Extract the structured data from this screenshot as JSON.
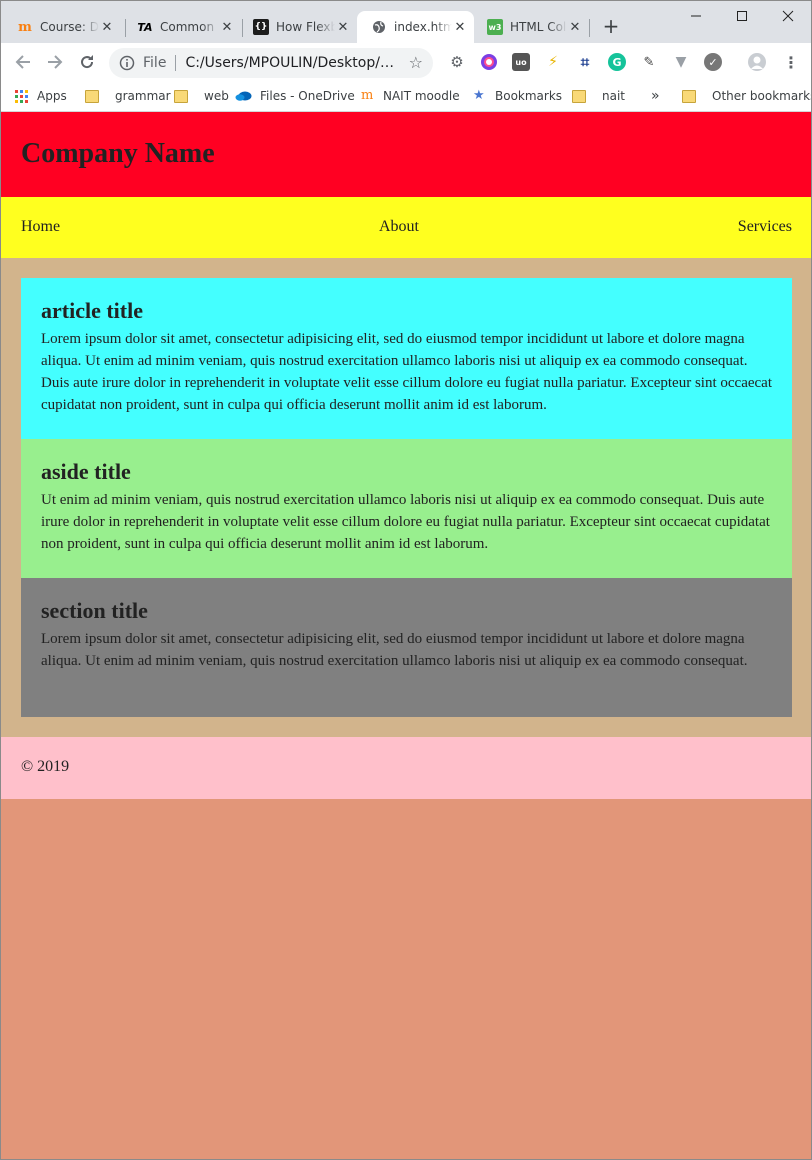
{
  "browser": {
    "tabs": [
      {
        "title": "Course: D",
        "favicon": "moodle-icon"
      },
      {
        "title": "Common",
        "favicon": "ta-icon"
      },
      {
        "title": "How Flexb",
        "favicon": "braces-icon"
      },
      {
        "title": "index.html",
        "favicon": "globe-icon",
        "active": true
      },
      {
        "title": "HTML Col",
        "favicon": "w3-icon"
      }
    ],
    "new_tab": "+",
    "address": {
      "scheme": "File",
      "url": "C:/Users/MPOULIN/Desktop/flexbox/index.html"
    },
    "bookmarks": [
      {
        "label": "Apps",
        "icon": "apps-grid-icon"
      },
      {
        "label": "grammar",
        "icon": "folder-icon"
      },
      {
        "label": "web",
        "icon": "folder-icon"
      },
      {
        "label": "Files - OneDrive",
        "icon": "onedrive-icon"
      },
      {
        "label": "NAIT moodle",
        "icon": "moodle-icon"
      },
      {
        "label": "Bookmarks",
        "icon": "star-icon"
      },
      {
        "label": "nait",
        "icon": "folder-icon"
      }
    ],
    "bookmarks_overflow": "»",
    "other_bookmarks": "Other bookmarks"
  },
  "page": {
    "header_title": "Company Name",
    "nav": [
      "Home",
      "About",
      "Services"
    ],
    "article": {
      "title": "article title",
      "text": "Lorem ipsum dolor sit amet, consectetur adipisicing elit, sed do eiusmod tempor incididunt ut labore et dolore magna aliqua. Ut enim ad minim veniam, quis nostrud exercitation ullamco laboris nisi ut aliquip ex ea commodo consequat. Duis aute irure dolor in reprehenderit in voluptate velit esse cillum dolore eu fugiat nulla pariatur. Excepteur sint occaecat cupidatat non proident, sunt in culpa qui officia deserunt mollit anim id est laborum."
    },
    "aside": {
      "title": "aside title",
      "text": "Ut enim ad minim veniam, quis nostrud exercitation ullamco laboris nisi ut aliquip ex ea commodo consequat. Duis aute irure dolor in reprehenderit in voluptate velit esse cillum dolore eu fugiat nulla pariatur. Excepteur sint occaecat cupidatat non proident, sunt in culpa qui officia deserunt mollit anim id est laborum."
    },
    "section": {
      "title": "section title",
      "text": "Lorem ipsum dolor sit amet, consectetur adipisicing elit, sed do eiusmod tempor incididunt ut labore et dolore magna aliqua. Ut enim ad minim veniam, quis nostrud exercitation ullamco laboris nisi ut aliquip ex ea commodo consequat."
    },
    "footer": "© 2019"
  },
  "colors": {
    "header": "#ff0022",
    "nav": "#ffff1f",
    "main": "#d2b48c",
    "article": "#44ffff",
    "aside": "#98ef8e",
    "section": "#808080",
    "footer": "#ffc0cb",
    "body": "#e29679"
  }
}
